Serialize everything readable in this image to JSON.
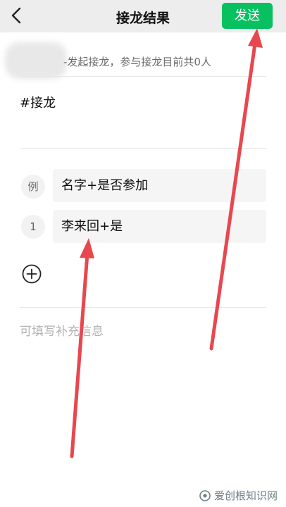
{
  "navbar": {
    "title": "接龙结果",
    "send_label": "发送",
    "back_icon": "chevron-left-icon"
  },
  "initiator": {
    "text": "-发起接龙，参与接龙目前共0人"
  },
  "topic": "#接龙",
  "rows": [
    {
      "badge": "例",
      "value": "名字+是否参加"
    },
    {
      "badge": "1",
      "value": "李来回+是"
    }
  ],
  "add_icon": "plus-circle-icon",
  "supplement_placeholder": "可填写补充信息",
  "watermark": "爱创根知识网",
  "colors": {
    "accent": "#07c160",
    "navbar_bg": "#ededed",
    "annotation_arrow": "#e8474e"
  }
}
